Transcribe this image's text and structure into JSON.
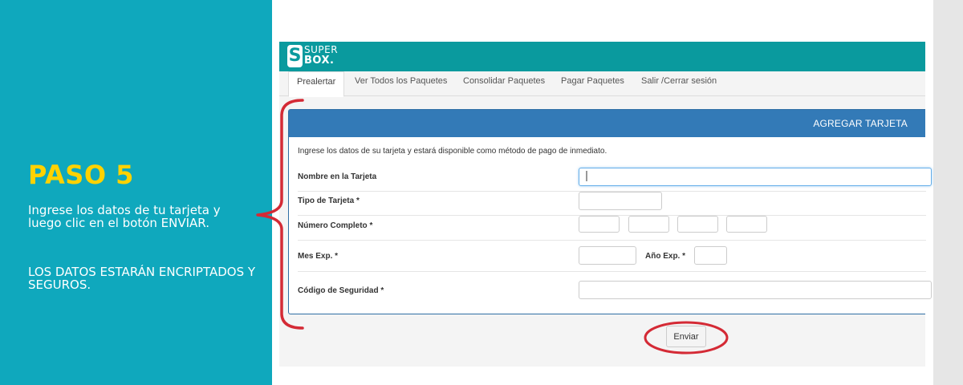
{
  "instructions": {
    "step_title": "PASO 5",
    "text_1": "Ingrese los datos de tu tarjeta y luego clic en el botón ENVIAR.",
    "text_2": "LOS DATOS ESTARÁN ENCRIPTADOS Y SEGUROS."
  },
  "site": {
    "logo_s": "S",
    "logo_super": "SUPER",
    "logo_box": "BOX."
  },
  "nav": {
    "tabs": [
      {
        "label": "Prealertar",
        "active": true
      },
      {
        "label": "Ver Todos los Paquetes"
      },
      {
        "label": "Consolidar Paquetes"
      },
      {
        "label": "Pagar Paquetes"
      },
      {
        "label": "Salir /Cerrar sesión"
      }
    ]
  },
  "form": {
    "title": "AGREGAR TARJETA",
    "intro": "Ingrese los datos de su tarjeta y estará disponible como método de pago de inmediato.",
    "labels": {
      "card_name": "Nombre en la Tarjeta",
      "card_type": "Tipo de Tarjeta *",
      "card_number": "Número Completo *",
      "exp_month": "Mes Exp. *",
      "exp_year": "Año Exp. *",
      "security_code": "Código de Seguridad *"
    },
    "values": {
      "card_name": "",
      "card_type": "",
      "card_number_1": "",
      "card_number_2": "",
      "card_number_3": "",
      "card_number_4": "",
      "exp_month": "",
      "exp_year": "",
      "security_code": ""
    },
    "submit_label": "Enviar"
  },
  "colors": {
    "teal_panel": "#0fa8bd",
    "step_title": "#ffd200",
    "header_teal": "#0a9a9e",
    "form_header_blue": "#337ab7",
    "annotation_red": "#d42a35"
  }
}
